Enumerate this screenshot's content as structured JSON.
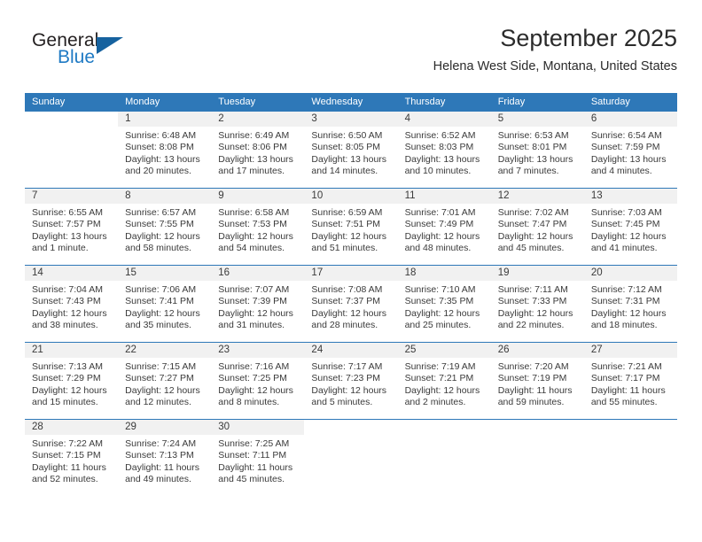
{
  "logo": {
    "word_top": "General",
    "word_bottom": "Blue",
    "accent_color": "#16629f",
    "blue_text_color": "#1f7ac4"
  },
  "header": {
    "title": "September 2025",
    "subtitle": "Helena West Side, Montana, United States"
  },
  "theme": {
    "header_blue": "#2e78b8",
    "daynum_band": "#f1f1f1",
    "text": "#3a3a3a"
  },
  "calendar": {
    "weekday_headers": [
      "Sunday",
      "Monday",
      "Tuesday",
      "Wednesday",
      "Thursday",
      "Friday",
      "Saturday"
    ],
    "weeks": [
      [
        {
          "day": "",
          "lines": []
        },
        {
          "day": "1",
          "lines": [
            "Sunrise: 6:48 AM",
            "Sunset: 8:08 PM",
            "Daylight: 13 hours",
            "and 20 minutes."
          ]
        },
        {
          "day": "2",
          "lines": [
            "Sunrise: 6:49 AM",
            "Sunset: 8:06 PM",
            "Daylight: 13 hours",
            "and 17 minutes."
          ]
        },
        {
          "day": "3",
          "lines": [
            "Sunrise: 6:50 AM",
            "Sunset: 8:05 PM",
            "Daylight: 13 hours",
            "and 14 minutes."
          ]
        },
        {
          "day": "4",
          "lines": [
            "Sunrise: 6:52 AM",
            "Sunset: 8:03 PM",
            "Daylight: 13 hours",
            "and 10 minutes."
          ]
        },
        {
          "day": "5",
          "lines": [
            "Sunrise: 6:53 AM",
            "Sunset: 8:01 PM",
            "Daylight: 13 hours",
            "and 7 minutes."
          ]
        },
        {
          "day": "6",
          "lines": [
            "Sunrise: 6:54 AM",
            "Sunset: 7:59 PM",
            "Daylight: 13 hours",
            "and 4 minutes."
          ]
        }
      ],
      [
        {
          "day": "7",
          "lines": [
            "Sunrise: 6:55 AM",
            "Sunset: 7:57 PM",
            "Daylight: 13 hours",
            "and 1 minute."
          ]
        },
        {
          "day": "8",
          "lines": [
            "Sunrise: 6:57 AM",
            "Sunset: 7:55 PM",
            "Daylight: 12 hours",
            "and 58 minutes."
          ]
        },
        {
          "day": "9",
          "lines": [
            "Sunrise: 6:58 AM",
            "Sunset: 7:53 PM",
            "Daylight: 12 hours",
            "and 54 minutes."
          ]
        },
        {
          "day": "10",
          "lines": [
            "Sunrise: 6:59 AM",
            "Sunset: 7:51 PM",
            "Daylight: 12 hours",
            "and 51 minutes."
          ]
        },
        {
          "day": "11",
          "lines": [
            "Sunrise: 7:01 AM",
            "Sunset: 7:49 PM",
            "Daylight: 12 hours",
            "and 48 minutes."
          ]
        },
        {
          "day": "12",
          "lines": [
            "Sunrise: 7:02 AM",
            "Sunset: 7:47 PM",
            "Daylight: 12 hours",
            "and 45 minutes."
          ]
        },
        {
          "day": "13",
          "lines": [
            "Sunrise: 7:03 AM",
            "Sunset: 7:45 PM",
            "Daylight: 12 hours",
            "and 41 minutes."
          ]
        }
      ],
      [
        {
          "day": "14",
          "lines": [
            "Sunrise: 7:04 AM",
            "Sunset: 7:43 PM",
            "Daylight: 12 hours",
            "and 38 minutes."
          ]
        },
        {
          "day": "15",
          "lines": [
            "Sunrise: 7:06 AM",
            "Sunset: 7:41 PM",
            "Daylight: 12 hours",
            "and 35 minutes."
          ]
        },
        {
          "day": "16",
          "lines": [
            "Sunrise: 7:07 AM",
            "Sunset: 7:39 PM",
            "Daylight: 12 hours",
            "and 31 minutes."
          ]
        },
        {
          "day": "17",
          "lines": [
            "Sunrise: 7:08 AM",
            "Sunset: 7:37 PM",
            "Daylight: 12 hours",
            "and 28 minutes."
          ]
        },
        {
          "day": "18",
          "lines": [
            "Sunrise: 7:10 AM",
            "Sunset: 7:35 PM",
            "Daylight: 12 hours",
            "and 25 minutes."
          ]
        },
        {
          "day": "19",
          "lines": [
            "Sunrise: 7:11 AM",
            "Sunset: 7:33 PM",
            "Daylight: 12 hours",
            "and 22 minutes."
          ]
        },
        {
          "day": "20",
          "lines": [
            "Sunrise: 7:12 AM",
            "Sunset: 7:31 PM",
            "Daylight: 12 hours",
            "and 18 minutes."
          ]
        }
      ],
      [
        {
          "day": "21",
          "lines": [
            "Sunrise: 7:13 AM",
            "Sunset: 7:29 PM",
            "Daylight: 12 hours",
            "and 15 minutes."
          ]
        },
        {
          "day": "22",
          "lines": [
            "Sunrise: 7:15 AM",
            "Sunset: 7:27 PM",
            "Daylight: 12 hours",
            "and 12 minutes."
          ]
        },
        {
          "day": "23",
          "lines": [
            "Sunrise: 7:16 AM",
            "Sunset: 7:25 PM",
            "Daylight: 12 hours",
            "and 8 minutes."
          ]
        },
        {
          "day": "24",
          "lines": [
            "Sunrise: 7:17 AM",
            "Sunset: 7:23 PM",
            "Daylight: 12 hours",
            "and 5 minutes."
          ]
        },
        {
          "day": "25",
          "lines": [
            "Sunrise: 7:19 AM",
            "Sunset: 7:21 PM",
            "Daylight: 12 hours",
            "and 2 minutes."
          ]
        },
        {
          "day": "26",
          "lines": [
            "Sunrise: 7:20 AM",
            "Sunset: 7:19 PM",
            "Daylight: 11 hours",
            "and 59 minutes."
          ]
        },
        {
          "day": "27",
          "lines": [
            "Sunrise: 7:21 AM",
            "Sunset: 7:17 PM",
            "Daylight: 11 hours",
            "and 55 minutes."
          ]
        }
      ],
      [
        {
          "day": "28",
          "lines": [
            "Sunrise: 7:22 AM",
            "Sunset: 7:15 PM",
            "Daylight: 11 hours",
            "and 52 minutes."
          ]
        },
        {
          "day": "29",
          "lines": [
            "Sunrise: 7:24 AM",
            "Sunset: 7:13 PM",
            "Daylight: 11 hours",
            "and 49 minutes."
          ]
        },
        {
          "day": "30",
          "lines": [
            "Sunrise: 7:25 AM",
            "Sunset: 7:11 PM",
            "Daylight: 11 hours",
            "and 45 minutes."
          ]
        },
        {
          "day": "",
          "lines": []
        },
        {
          "day": "",
          "lines": []
        },
        {
          "day": "",
          "lines": []
        },
        {
          "day": "",
          "lines": []
        }
      ]
    ]
  }
}
